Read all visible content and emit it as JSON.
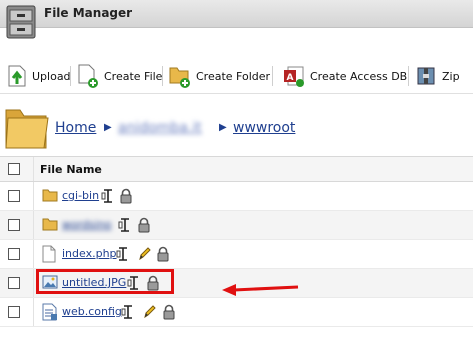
{
  "app": {
    "title": "File Manager"
  },
  "toolbar": {
    "upload": "Upload",
    "create_file": "Create File",
    "create_folder": "Create Folder",
    "create_access_db": "Create Access DB",
    "zip": "Zip"
  },
  "breadcrumb": {
    "home": "Home",
    "domain": "anidomba.it",
    "current": "wwwroot"
  },
  "table": {
    "header": "File Name",
    "rows": [
      {
        "name": "cgi-bin",
        "type": "folder",
        "editable": false
      },
      {
        "name": "wordsino",
        "type": "folder",
        "editable": false
      },
      {
        "name": "index.php",
        "type": "file",
        "editable": true
      },
      {
        "name": "untitled.JPG",
        "type": "image",
        "editable": false
      },
      {
        "name": "web.config",
        "type": "config",
        "editable": true
      }
    ]
  },
  "colors": {
    "link": "#1f3f8f",
    "highlight": "#e01010",
    "folder": "#e8b84a"
  },
  "icons": [
    "file-cabinet-icon",
    "upload-icon",
    "create-file-icon",
    "create-folder-icon",
    "access-db-icon",
    "zip-icon",
    "folder-icon",
    "file-icon",
    "image-icon",
    "config-icon",
    "rename-icon",
    "edit-icon",
    "lock-icon"
  ]
}
